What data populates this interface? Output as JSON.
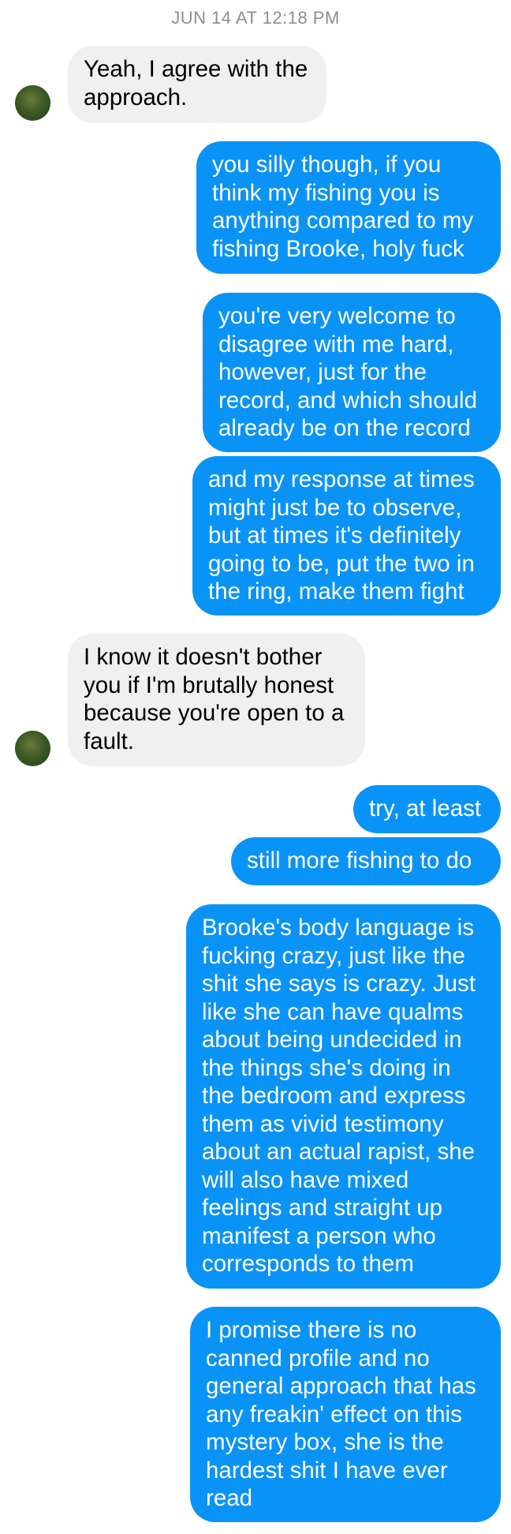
{
  "header": {
    "timestamp": "JUN 14 AT 12:18 PM"
  },
  "messages": [
    {
      "side": "in",
      "text": "Yeah, I agree with the\napproach."
    },
    {
      "side": "out",
      "text": "you silly though, if you\nthink my fishing you is\nanything compared to my\nfishing Brooke, holy fuck"
    },
    {
      "side": "out",
      "text": "you're very welcome to\ndisagree with me hard,\nhowever, just for the\nrecord, and which should\nalready be on the record"
    },
    {
      "side": "out",
      "text": "and my response at times\nmight just be to observe,\nbut at times it's definitely\ngoing to be, put the two in\nthe ring, make them fight"
    },
    {
      "side": "in",
      "text": "I know it doesn't bother\nyou if I'm brutally honest\nbecause you're open to a\nfault."
    },
    {
      "side": "out",
      "text": "try, at least"
    },
    {
      "side": "out",
      "text": "still more fishing to do"
    },
    {
      "side": "out",
      "text": "Brooke's body language is\nfucking crazy, just like the\nshit she says is crazy. Just\nlike she can have qualms\nabout being undecided in\nthe things she's doing in\nthe bedroom and express\nthem as vivid testimony\nabout an actual rapist, she\nwill also have mixed\nfeelings and straight up\nmanifest a person who\ncorresponds to them"
    },
    {
      "side": "out",
      "text": "I promise there is no\ncanned profile and no\ngeneral approach that has\nany freakin' effect on this\nmystery box, she is the\nhardest shit I have ever\nread"
    }
  ]
}
